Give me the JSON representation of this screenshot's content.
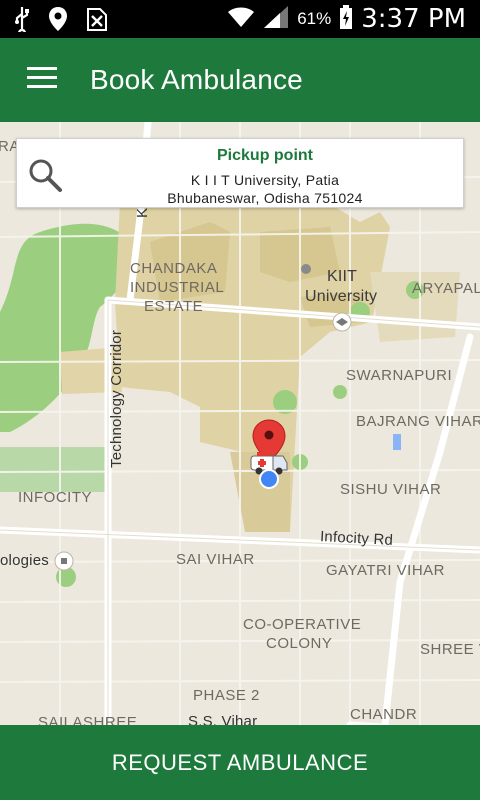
{
  "status_bar": {
    "icons": [
      "usb-icon",
      "location-icon",
      "no-sim-icon",
      "wifi-icon",
      "signal-icon",
      "battery-charging-icon"
    ],
    "battery_percent": "61%",
    "time": "3:37 PM"
  },
  "app_bar": {
    "menu_icon": "hamburger-menu-icon",
    "title": "Book Ambulance"
  },
  "pickup": {
    "icon": "search-icon",
    "title": "Pickup point",
    "address_line1": "K I I T University, Patia",
    "address_line2": "Bhubaneswar, Odisha 751024"
  },
  "map": {
    "labels": {
      "chandaka_1": "CHANDAKA",
      "chandaka_2": "INDUSTRIAL",
      "chandaka_3": "ESTATE",
      "kiit_1": "KIIT",
      "kiit_2": "University",
      "aryapalli": "ARYAPALI",
      "swarnapuri": "SWARNAPURI",
      "bajrang_vihar": "BAJRANG VIHAR",
      "technology_corridor": "Technology Corridor",
      "infocity": "INFOCITY",
      "sishu_vihar": "SISHU VIHAR",
      "infocity_rd": "Infocity Rd",
      "sai_vihar": "SAI VIHAR",
      "gayatri_vihar": "GAYATRI VIHAR",
      "technologies": "ologies",
      "cooperative_1": "CO-OPERATIVE",
      "cooperative_2": "COLONY",
      "shree_v": "SHREE V",
      "phase_2": "PHASE 2",
      "sailashree": "SAILASHREE",
      "ss_vihar": "S.S. Vihar",
      "chandra": "CHANDR",
      "kiss": "Kiss",
      "ra": "RA"
    },
    "markers": [
      "pickup-pin-icon",
      "ambulance-icon",
      "current-location-dot"
    ],
    "colors": {
      "land": "#ece8dd",
      "campus": "#dfd2a4",
      "park": "#9bcf7f",
      "road": "#ffffff",
      "pin": "#e53935",
      "location_dot": "#4285f4"
    }
  },
  "bottom_button": {
    "label": "REQUEST AMBULANCE",
    "color": "#1e7a3c"
  }
}
